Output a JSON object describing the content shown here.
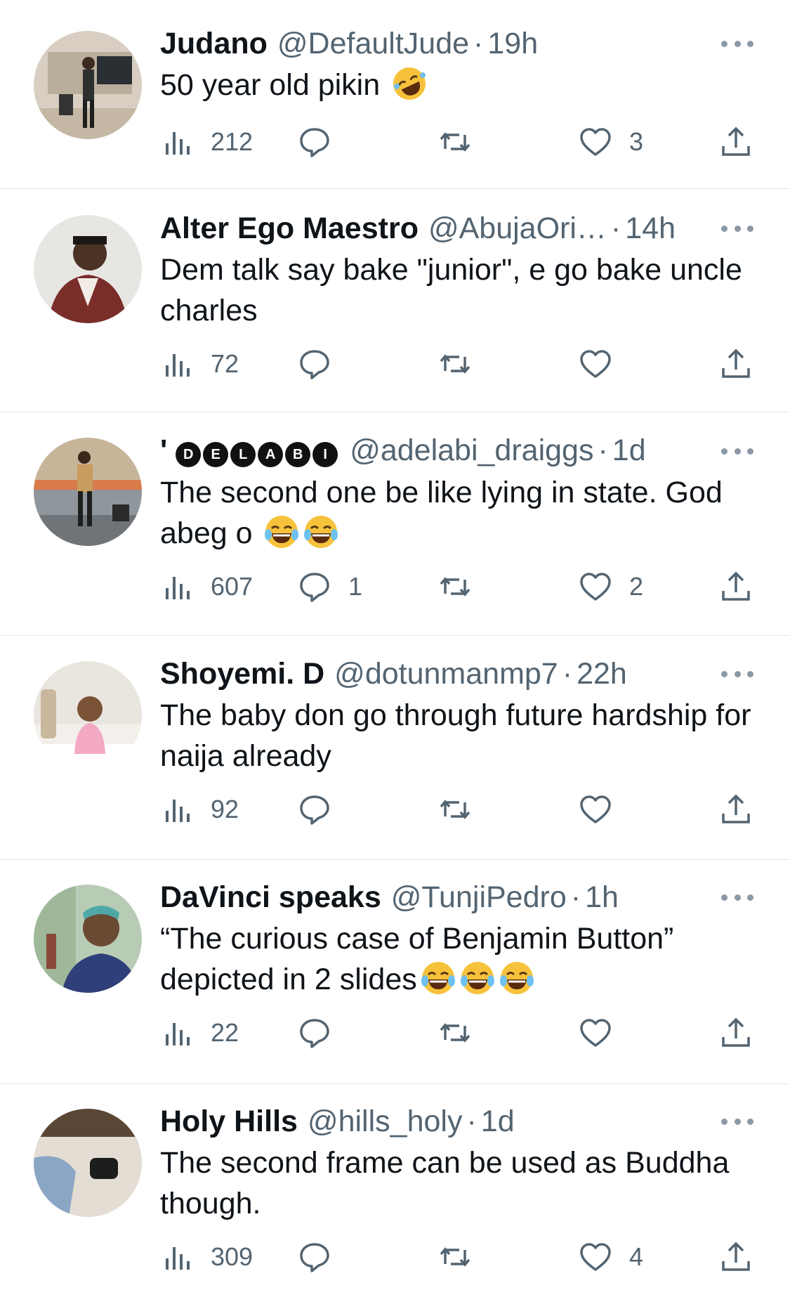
{
  "tweets": [
    {
      "name": "Judano",
      "handle": "@DefaultJude",
      "separator": "·",
      "time": "19h",
      "body": "50 year old pikin",
      "emojis": [
        "rofl"
      ],
      "views": "212",
      "replies": "",
      "retweets": "",
      "likes": "3"
    },
    {
      "name": "Alter Ego Maestro",
      "handle": "@AbujaOri…",
      "separator": "·",
      "time": "14h",
      "body": "Dem talk say bake \"junior\", e go bake uncle charles",
      "emojis": [],
      "views": "72",
      "replies": "",
      "retweets": "",
      "likes": ""
    },
    {
      "name": "'",
      "name_badges": [
        "D",
        "E",
        "L",
        "A",
        "B",
        "I"
      ],
      "handle": "@adelabi_draiggs",
      "separator": "·",
      "time": "1d",
      "body": "The second one be like lying in state. God abeg o",
      "emojis": [
        "joy",
        "joy"
      ],
      "views": "607",
      "replies": "1",
      "retweets": "",
      "likes": "2"
    },
    {
      "name": "Shoyemi. D",
      "handle": "@dotunmanmp7",
      "separator": "·",
      "time": "22h",
      "body": "The baby don go through future hardship for naija already",
      "emojis": [],
      "views": "92",
      "replies": "",
      "retweets": "",
      "likes": ""
    },
    {
      "name": "DaVinci speaks",
      "handle": "@TunjiPedro",
      "separator": "·",
      "time": "1h",
      "body": "“The curious case of Benjamin Button” depicted in 2 slides",
      "emojis": [
        "joy",
        "joy",
        "joy"
      ],
      "views": "22",
      "replies": "",
      "retweets": "",
      "likes": ""
    },
    {
      "name": "Holy Hills",
      "handle": "@hills_holy",
      "separator": "·",
      "time": "1d",
      "body": "The second frame can be used as Buddha though.",
      "emojis": [],
      "views": "309",
      "replies": "",
      "retweets": "",
      "likes": "4"
    }
  ],
  "icons": {
    "views": "views-icon",
    "reply": "reply-icon",
    "retweet": "retweet-icon",
    "like": "like-icon",
    "share": "share-icon",
    "more": "more-icon"
  },
  "colors": {
    "text": "#0f1419",
    "secondary": "#536471",
    "divider": "#e6e6e6",
    "emoji": "#f7c23b"
  }
}
